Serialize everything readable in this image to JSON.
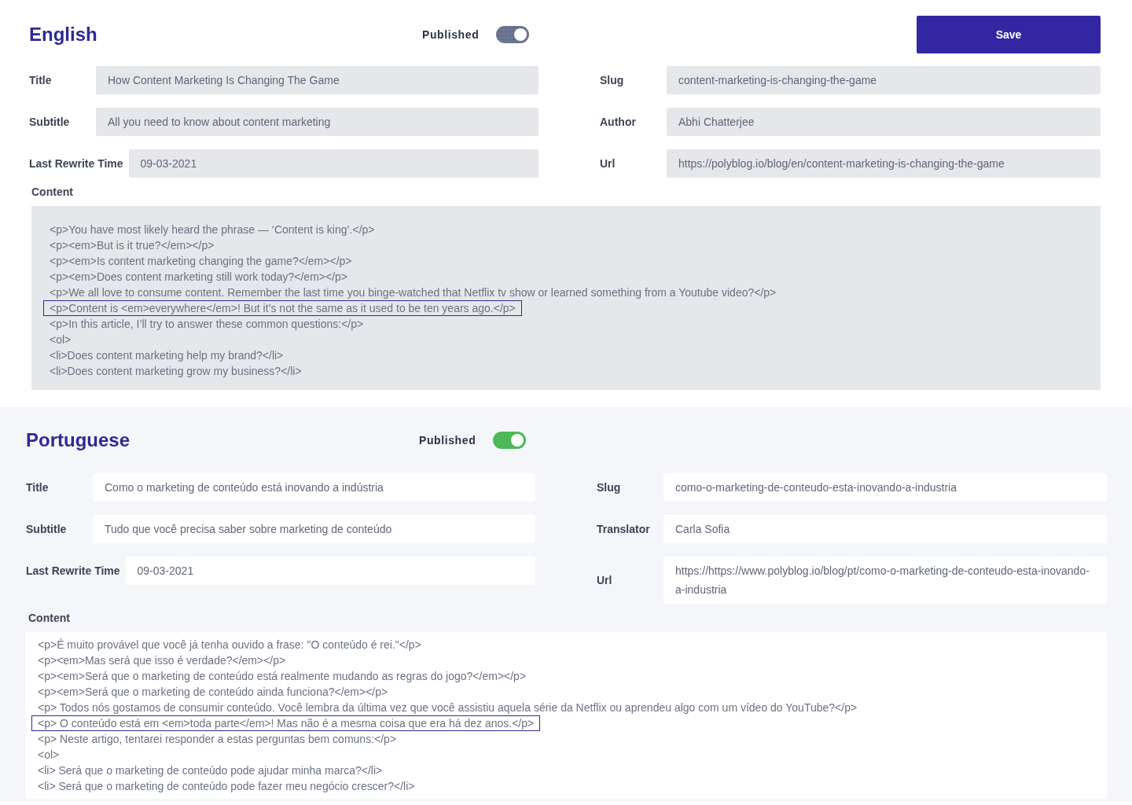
{
  "sections": [
    {
      "kind": "source",
      "language": "English",
      "published_label": "Published",
      "published": true,
      "disabled": true,
      "save_button": "Save",
      "left_fields": [
        {
          "label": "Title",
          "value": "How Content Marketing Is Changing The Game"
        },
        {
          "label": "Subtitle",
          "value": "All you need to know about content marketing"
        },
        {
          "label": "Last Rewrite Time",
          "value": "09-03-2021"
        }
      ],
      "right_fields": [
        {
          "label": "Slug",
          "value": "content-marketing-is-changing-the-game"
        },
        {
          "label": "Author",
          "value": "Abhi Chatterjee"
        },
        {
          "label": "Url",
          "value": "https://polyblog.io/blog/en/content-marketing-is-changing-the-game"
        }
      ],
      "content_label": "Content",
      "content_lines": [
        {
          "text": "<p>You have most likely heard the phrase — ‘Content is king’.</p>",
          "highlighted": false
        },
        {
          "text": "<p><em>But is it true?</em></p>",
          "highlighted": false
        },
        {
          "text": "<p><em>Is content marketing changing the game?</em></p>",
          "highlighted": false
        },
        {
          "text": "<p><em>Does content marketing still work today?</em></p>",
          "highlighted": false
        },
        {
          "text": "<p>We all love to consume content. Remember the last time you binge-watched that Netflix tv show or learned something from a Youtube video?</p>",
          "highlighted": false
        },
        {
          "text": "<p>Content is <em>everywhere</em>! But it’s not the same as it used to be ten years ago.</p>",
          "highlighted": true
        },
        {
          "text": "<p>In this article, I’ll try to answer these common questions:</p>",
          "highlighted": false
        },
        {
          "text": "<ol>",
          "highlighted": false
        },
        {
          "text": "<li>Does content marketing help my brand?</li>",
          "highlighted": false
        },
        {
          "text": "<li>Does content marketing grow my business?</li>",
          "highlighted": false
        }
      ]
    },
    {
      "kind": "translation",
      "language": "Portuguese",
      "published_label": "Published",
      "published": true,
      "disabled": false,
      "left_fields": [
        {
          "label": "Title",
          "value": "Como o marketing de conteúdo está inovando a indústria"
        },
        {
          "label": "Subtitle",
          "value": "Tudo que você precisa saber sobre marketing de conteúdo"
        },
        {
          "label": "Last Rewrite Time",
          "value": "09-03-2021"
        }
      ],
      "right_fields": [
        {
          "label": "Slug",
          "value": "como-o-marketing-de-conteudo-esta-inovando-a-industria"
        },
        {
          "label": "Translator",
          "value": "Carla Sofia"
        },
        {
          "label": "Url",
          "value": "https://https://www.polyblog.io/blog/pt/como-o-marketing-de-conteudo-esta-inovando-a-industria"
        }
      ],
      "content_label": "Content",
      "content_lines": [
        {
          "text": "<p>É muito provável que você já tenha ouvido a frase: \"O conteúdo é rei.\"</p>",
          "highlighted": false
        },
        {
          "text": "<p><em>Mas será que isso é verdade?</em></p>",
          "highlighted": false
        },
        {
          "text": "<p><em>Será que o marketing de conteúdo está realmente mudando as regras do jogo?</em></p>",
          "highlighted": false
        },
        {
          "text": "<p><em>Será que o marketing de conteúdo ainda funciona?</em></p>",
          "highlighted": false
        },
        {
          "text": "<p> Todos nós gostamos de consumir conteúdo. Você lembra da última vez que você assistiu aquela série da Netflix ou aprendeu algo com um vídeo do YouTube?</p>",
          "highlighted": false
        },
        {
          "text": "<p> O conteúdo está em <em>toda parte</em>! Mas não é a mesma coisa que era há dez anos.</p>",
          "highlighted": true
        },
        {
          "text": "<p> Neste artigo, tentarei responder a estas perguntas bem comuns:</p>",
          "highlighted": false
        },
        {
          "text": "<ol>",
          "highlighted": false
        },
        {
          "text": "<li> Será que o marketing de conteúdo pode ajudar minha marca?</li>",
          "highlighted": false
        },
        {
          "text": "<li> Será que o marketing de conteúdo pode fazer meu negócio crescer?</li>",
          "highlighted": false
        }
      ]
    }
  ]
}
